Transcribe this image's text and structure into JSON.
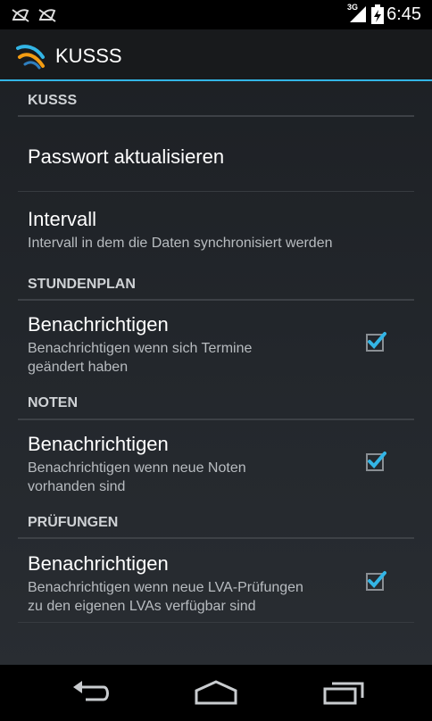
{
  "status_bar": {
    "time": "6:45",
    "network_type": "3G",
    "icons": [
      "notification-icon",
      "notification-icon",
      "signal-icon",
      "battery-icon"
    ]
  },
  "app": {
    "title": "KUSSS",
    "accent_color": "#33b5e5"
  },
  "sections": [
    {
      "category": "KUSSS",
      "items": [
        {
          "title": "Passwort aktualisieren"
        },
        {
          "title": "Intervall",
          "summary": "Intervall in dem die Daten synchronisiert werden"
        }
      ]
    },
    {
      "category": "STUNDENPLAN",
      "items": [
        {
          "title": "Benachrichtigen",
          "summary_line1": "Benachrichtigen wenn sich Termine",
          "summary_line2": "geändert haben",
          "checked": true
        }
      ]
    },
    {
      "category": "NOTEN",
      "items": [
        {
          "title": "Benachrichtigen",
          "summary_line1": "Benachrichtigen wenn neue Noten",
          "summary_line2": "vorhanden sind",
          "checked": true
        }
      ]
    },
    {
      "category": "PRÜFUNGEN",
      "items": [
        {
          "title": "Benachrichtigen",
          "summary_line1": "Benachrichtigen wenn neue LVA-Prüfungen",
          "summary_line2": "zu den eigenen LVAs verfügbar sind",
          "checked": true
        }
      ]
    }
  ],
  "nav_bar": {
    "buttons": [
      "back-icon",
      "home-icon",
      "recent-apps-icon"
    ]
  }
}
